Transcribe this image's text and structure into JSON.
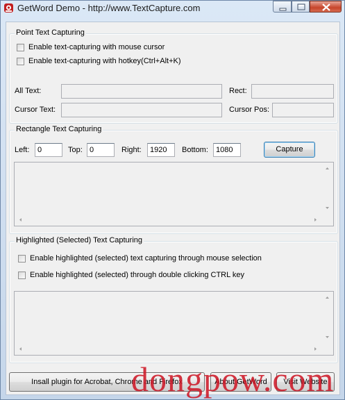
{
  "window": {
    "title": "GetWord Demo - http://www.TextCapture.com",
    "accent_close": "#c7452b"
  },
  "point_group": {
    "legend": "Point Text Capturing",
    "cb_mouse": "Enable text-capturing with mouse cursor",
    "cb_hotkey": "Enable text-capturing with hotkey(Ctrl+Alt+K)",
    "all_text_label": "All Text:",
    "rect_label": "Rect:",
    "cursor_text_label": "Cursor Text:",
    "cursor_pos_label": "Cursor Pos:"
  },
  "rect_group": {
    "legend": "Rectangle Text Capturing",
    "left_label": "Left:",
    "left_value": "0",
    "top_label": "Top:",
    "top_value": "0",
    "right_label": "Right:",
    "right_value": "1920",
    "bottom_label": "Bottom:",
    "bottom_value": "1080",
    "capture_label": "Capture"
  },
  "highlight_group": {
    "legend": "Highlighted (Selected) Text Capturing",
    "cb_selection": "Enable highlighted (selected) text capturing through mouse selection",
    "cb_ctrl": "Enable highlighted (selected) through double clicking CTRL key"
  },
  "footer": {
    "install_label": "Insall plugin for Acrobat, Chrome and Firefox",
    "about_label": "About GetWord",
    "visit_label": "Visit Website"
  },
  "watermark": "dongpow.com"
}
